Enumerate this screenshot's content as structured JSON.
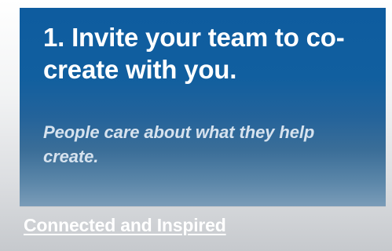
{
  "card": {
    "title": "1. Invite your team to co-create with you.",
    "subtitle": "People care about what they help create."
  },
  "caption": {
    "link_text": "Connected and Inspired"
  },
  "colors": {
    "card_top": "#0e5c9f",
    "card_bottom": "#7a9cb8",
    "title_text": "#ffffff",
    "subtitle_text": "#d6e2ee",
    "link_text": "#ffffff",
    "page_background": "#c9ccd0"
  }
}
